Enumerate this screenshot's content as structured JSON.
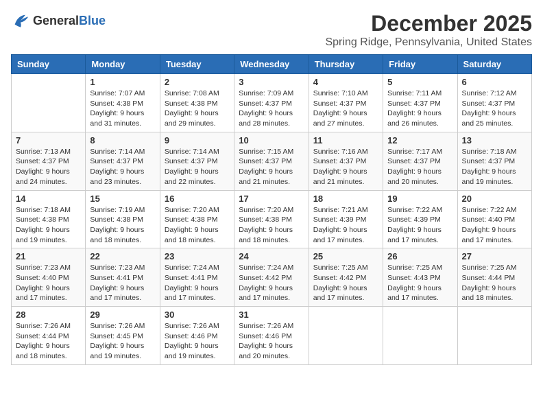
{
  "header": {
    "logo_general": "General",
    "logo_blue": "Blue",
    "title": "December 2025",
    "subtitle": "Spring Ridge, Pennsylvania, United States"
  },
  "days_of_week": [
    "Sunday",
    "Monday",
    "Tuesday",
    "Wednesday",
    "Thursday",
    "Friday",
    "Saturday"
  ],
  "weeks": [
    [
      {
        "day": "",
        "sunrise": "",
        "sunset": "",
        "daylight": ""
      },
      {
        "day": "1",
        "sunrise": "Sunrise: 7:07 AM",
        "sunset": "Sunset: 4:38 PM",
        "daylight": "Daylight: 9 hours and 31 minutes."
      },
      {
        "day": "2",
        "sunrise": "Sunrise: 7:08 AM",
        "sunset": "Sunset: 4:38 PM",
        "daylight": "Daylight: 9 hours and 29 minutes."
      },
      {
        "day": "3",
        "sunrise": "Sunrise: 7:09 AM",
        "sunset": "Sunset: 4:37 PM",
        "daylight": "Daylight: 9 hours and 28 minutes."
      },
      {
        "day": "4",
        "sunrise": "Sunrise: 7:10 AM",
        "sunset": "Sunset: 4:37 PM",
        "daylight": "Daylight: 9 hours and 27 minutes."
      },
      {
        "day": "5",
        "sunrise": "Sunrise: 7:11 AM",
        "sunset": "Sunset: 4:37 PM",
        "daylight": "Daylight: 9 hours and 26 minutes."
      },
      {
        "day": "6",
        "sunrise": "Sunrise: 7:12 AM",
        "sunset": "Sunset: 4:37 PM",
        "daylight": "Daylight: 9 hours and 25 minutes."
      }
    ],
    [
      {
        "day": "7",
        "sunrise": "Sunrise: 7:13 AM",
        "sunset": "Sunset: 4:37 PM",
        "daylight": "Daylight: 9 hours and 24 minutes."
      },
      {
        "day": "8",
        "sunrise": "Sunrise: 7:14 AM",
        "sunset": "Sunset: 4:37 PM",
        "daylight": "Daylight: 9 hours and 23 minutes."
      },
      {
        "day": "9",
        "sunrise": "Sunrise: 7:14 AM",
        "sunset": "Sunset: 4:37 PM",
        "daylight": "Daylight: 9 hours and 22 minutes."
      },
      {
        "day": "10",
        "sunrise": "Sunrise: 7:15 AM",
        "sunset": "Sunset: 4:37 PM",
        "daylight": "Daylight: 9 hours and 21 minutes."
      },
      {
        "day": "11",
        "sunrise": "Sunrise: 7:16 AM",
        "sunset": "Sunset: 4:37 PM",
        "daylight": "Daylight: 9 hours and 21 minutes."
      },
      {
        "day": "12",
        "sunrise": "Sunrise: 7:17 AM",
        "sunset": "Sunset: 4:37 PM",
        "daylight": "Daylight: 9 hours and 20 minutes."
      },
      {
        "day": "13",
        "sunrise": "Sunrise: 7:18 AM",
        "sunset": "Sunset: 4:37 PM",
        "daylight": "Daylight: 9 hours and 19 minutes."
      }
    ],
    [
      {
        "day": "14",
        "sunrise": "Sunrise: 7:18 AM",
        "sunset": "Sunset: 4:38 PM",
        "daylight": "Daylight: 9 hours and 19 minutes."
      },
      {
        "day": "15",
        "sunrise": "Sunrise: 7:19 AM",
        "sunset": "Sunset: 4:38 PM",
        "daylight": "Daylight: 9 hours and 18 minutes."
      },
      {
        "day": "16",
        "sunrise": "Sunrise: 7:20 AM",
        "sunset": "Sunset: 4:38 PM",
        "daylight": "Daylight: 9 hours and 18 minutes."
      },
      {
        "day": "17",
        "sunrise": "Sunrise: 7:20 AM",
        "sunset": "Sunset: 4:38 PM",
        "daylight": "Daylight: 9 hours and 18 minutes."
      },
      {
        "day": "18",
        "sunrise": "Sunrise: 7:21 AM",
        "sunset": "Sunset: 4:39 PM",
        "daylight": "Daylight: 9 hours and 17 minutes."
      },
      {
        "day": "19",
        "sunrise": "Sunrise: 7:22 AM",
        "sunset": "Sunset: 4:39 PM",
        "daylight": "Daylight: 9 hours and 17 minutes."
      },
      {
        "day": "20",
        "sunrise": "Sunrise: 7:22 AM",
        "sunset": "Sunset: 4:40 PM",
        "daylight": "Daylight: 9 hours and 17 minutes."
      }
    ],
    [
      {
        "day": "21",
        "sunrise": "Sunrise: 7:23 AM",
        "sunset": "Sunset: 4:40 PM",
        "daylight": "Daylight: 9 hours and 17 minutes."
      },
      {
        "day": "22",
        "sunrise": "Sunrise: 7:23 AM",
        "sunset": "Sunset: 4:41 PM",
        "daylight": "Daylight: 9 hours and 17 minutes."
      },
      {
        "day": "23",
        "sunrise": "Sunrise: 7:24 AM",
        "sunset": "Sunset: 4:41 PM",
        "daylight": "Daylight: 9 hours and 17 minutes."
      },
      {
        "day": "24",
        "sunrise": "Sunrise: 7:24 AM",
        "sunset": "Sunset: 4:42 PM",
        "daylight": "Daylight: 9 hours and 17 minutes."
      },
      {
        "day": "25",
        "sunrise": "Sunrise: 7:25 AM",
        "sunset": "Sunset: 4:42 PM",
        "daylight": "Daylight: 9 hours and 17 minutes."
      },
      {
        "day": "26",
        "sunrise": "Sunrise: 7:25 AM",
        "sunset": "Sunset: 4:43 PM",
        "daylight": "Daylight: 9 hours and 17 minutes."
      },
      {
        "day": "27",
        "sunrise": "Sunrise: 7:25 AM",
        "sunset": "Sunset: 4:44 PM",
        "daylight": "Daylight: 9 hours and 18 minutes."
      }
    ],
    [
      {
        "day": "28",
        "sunrise": "Sunrise: 7:26 AM",
        "sunset": "Sunset: 4:44 PM",
        "daylight": "Daylight: 9 hours and 18 minutes."
      },
      {
        "day": "29",
        "sunrise": "Sunrise: 7:26 AM",
        "sunset": "Sunset: 4:45 PM",
        "daylight": "Daylight: 9 hours and 19 minutes."
      },
      {
        "day": "30",
        "sunrise": "Sunrise: 7:26 AM",
        "sunset": "Sunset: 4:46 PM",
        "daylight": "Daylight: 9 hours and 19 minutes."
      },
      {
        "day": "31",
        "sunrise": "Sunrise: 7:26 AM",
        "sunset": "Sunset: 4:46 PM",
        "daylight": "Daylight: 9 hours and 20 minutes."
      },
      {
        "day": "",
        "sunrise": "",
        "sunset": "",
        "daylight": ""
      },
      {
        "day": "",
        "sunrise": "",
        "sunset": "",
        "daylight": ""
      },
      {
        "day": "",
        "sunrise": "",
        "sunset": "",
        "daylight": ""
      }
    ]
  ]
}
